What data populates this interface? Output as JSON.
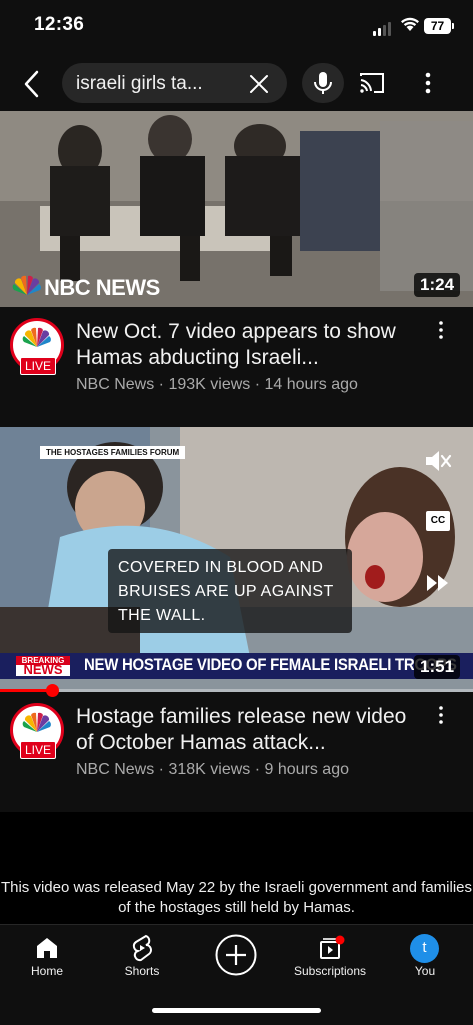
{
  "status_bar": {
    "time": "12:36",
    "battery": "77"
  },
  "search": {
    "query": "israeli girls ta..."
  },
  "videos": [
    {
      "overlay_logo_text": "NBC NEWS",
      "duration": "1:24",
      "avatar_live": "LIVE",
      "title": "New Oct. 7 video appears to show Hamas abducting Israeli...",
      "meta": "NBC News · 193K views · 14 hours ago"
    },
    {
      "tag": "THE HOSTAGES FAMILIES FORUM",
      "caption": "COVERED IN BLOOD AND BRUISES ARE UP AGAINST THE WALL.",
      "breaking_top": "BREAKING",
      "breaking_bottom": "NEWS",
      "ticker": "NEW HOSTAGE VIDEO OF FEMALE ISRAELI TROOPS",
      "duration": "1:51",
      "cc_label": "CC",
      "progress": 0.11,
      "avatar_live": "LIVE",
      "title": "Hostage families release new video of October Hamas attack...",
      "meta": "NBC News · 318K views · 9 hours ago"
    },
    {
      "text": "This video was released May 22 by the Israeli government and families of the hostages still held by Hamas."
    }
  ],
  "bottom_nav": {
    "items": [
      {
        "label": "Home",
        "icon": "home-icon"
      },
      {
        "label": "Shorts",
        "icon": "shorts-icon"
      },
      {
        "label": "",
        "icon": "create-icon"
      },
      {
        "label": "Subscriptions",
        "icon": "subscriptions-icon"
      },
      {
        "label": "You",
        "icon": "avatar-icon",
        "avatar_letter": "t"
      }
    ]
  },
  "colors": {
    "accent": "#ff0000",
    "live_red": "#e0001b",
    "avatar_blue": "#1f8fe8",
    "ticker_blue": "#1a1f5e"
  }
}
